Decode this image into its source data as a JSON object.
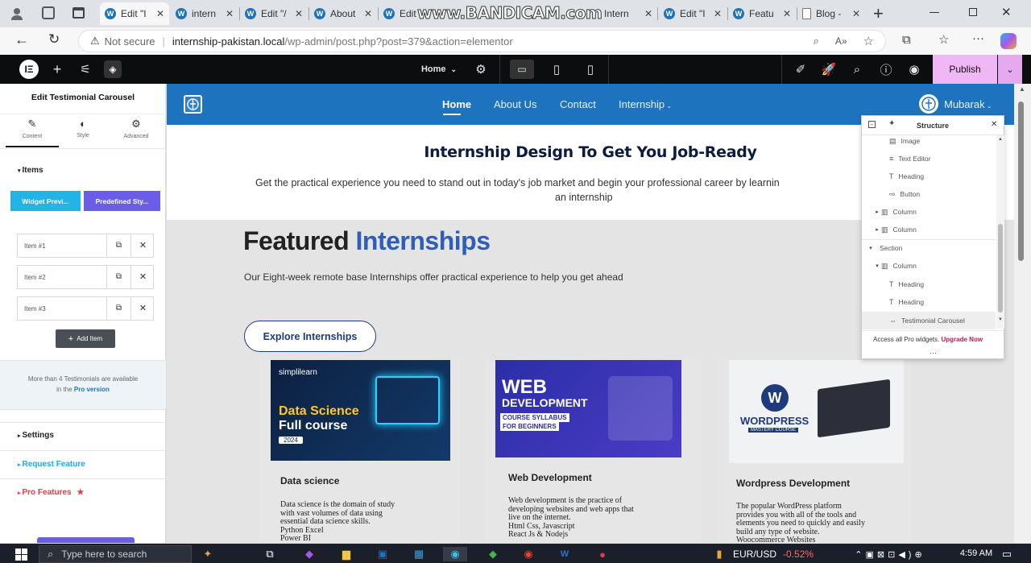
{
  "watermark": "www.BANDICAM.com",
  "browser": {
    "tabs": [
      {
        "label": "Edit \"I",
        "icon": "wordpress-icon"
      },
      {
        "label": "intern",
        "icon": "wordpress-icon"
      },
      {
        "label": "Edit \"/",
        "icon": "wordpress-icon"
      },
      {
        "label": "About",
        "icon": "wordpress-icon"
      },
      {
        "label": "Edit",
        "icon": "wordpress-icon"
      },
      {
        "label": "Intern",
        "icon": "wordpress-icon"
      },
      {
        "label": "Edit \"I",
        "icon": "wordpress-icon"
      },
      {
        "label": "Featu",
        "icon": "wordpress-icon"
      },
      {
        "label": "Blog -",
        "icon": "document-icon"
      }
    ],
    "not_secure": "Not secure",
    "url_host": "internship-pakistan.local",
    "url_path": "/wp-admin/post.php?post=379&action=elementor"
  },
  "editor": {
    "page_selector": "Home",
    "publish": "Publish"
  },
  "panel": {
    "title": "Edit Testimonial Carousel",
    "tabs": [
      "Content",
      "Style",
      "Advanced"
    ],
    "items_heading": "Items",
    "widget_preview": "Widget Previ...",
    "predefined_style": "Predefined Sty...",
    "items": [
      "Item #1",
      "Item #2",
      "Item #3"
    ],
    "add_item": "Add Item",
    "pro_note_1": "More than 4 Testimonials are available",
    "pro_note_2": "in the",
    "pro_note_link": "Pro version",
    "settings": "Settings",
    "request_feature": "Request Feature",
    "pro_features": "Pro Features"
  },
  "site": {
    "nav": [
      "Home",
      "About Us",
      "Contact",
      "Internship"
    ],
    "user": "Mubarak",
    "hero_title": "Internship Design To Get You Job-Ready",
    "hero_text_1": "Get the practical experience you need to stand out in today's job market and begin your professional career by learnin",
    "hero_text_2": "an internship",
    "featured_word1": "Featured",
    "featured_word2": "Internships",
    "featured_sub": "Our Eight-week remote base Internships offer practical experience to help you get ahead",
    "explore_btn": "Explore Internships",
    "cards": [
      {
        "img_brand": "simplilearn",
        "img_line1": "Data Science",
        "img_line2": "Full course",
        "img_year": "2024",
        "title": "Data science",
        "text": [
          "Data science is the domain of study",
          "with vast volumes of data using",
          "essential data science skills.",
          "Python Excel",
          "Power BI"
        ]
      },
      {
        "img_brand": "WEB",
        "img_line1": "DEVELOPMENT",
        "img_line2": "COURSE SYLLABUS",
        "img_year": "FOR BEGINNERS",
        "title": "Web Development",
        "text": [
          "Web development is the practice of",
          "developing websites and web apps that",
          "live on the internet.",
          "Html Css, Javascript",
          "React Js & Nodejs"
        ]
      },
      {
        "img_brand": "WORDPRESS",
        "img_line1": "MASTERY COURSE",
        "img_line2": "",
        "img_year": "",
        "title": "Wordpress Development",
        "text": [
          "The popular WordPress platform",
          "provides you with all of the tools and",
          "elements you need to quickly and easily",
          "build any type of website.",
          "Woocommerce Websites"
        ]
      }
    ]
  },
  "structure": {
    "title": "Structure",
    "rows": [
      {
        "label": "Image",
        "icon": "image-icon",
        "level": 2,
        "arrow": ""
      },
      {
        "label": "Text Editor",
        "icon": "text-editor-icon",
        "level": 2,
        "arrow": ""
      },
      {
        "label": "Heading",
        "icon": "heading-icon",
        "level": 2,
        "arrow": ""
      },
      {
        "label": "Button",
        "icon": "button-icon",
        "level": 2,
        "arrow": ""
      },
      {
        "label": "Column",
        "icon": "column-icon",
        "level": 1,
        "arrow": "▸"
      },
      {
        "label": "Column",
        "icon": "column-icon",
        "level": 1,
        "arrow": "▸"
      },
      {
        "label": "Section",
        "icon": "",
        "level": 0,
        "arrow": "▾"
      },
      {
        "label": "Column",
        "icon": "column-icon",
        "level": 1,
        "arrow": "▾"
      },
      {
        "label": "Heading",
        "icon": "heading-icon",
        "level": 2,
        "arrow": ""
      },
      {
        "label": "Heading",
        "icon": "heading-icon",
        "level": 2,
        "arrow": ""
      },
      {
        "label": "Testimonial Carousel",
        "icon": "carousel-icon",
        "level": 2,
        "arrow": ""
      }
    ],
    "footer_text": "Access all Pro widgets.",
    "footer_link": "Upgrade Now"
  },
  "taskbar": {
    "search_placeholder": "Type here to search",
    "ticker": "EUR/USD",
    "ticker_change": "-0.52%",
    "time": "4:59 AM"
  },
  "colors": {
    "elementor_dark": "#0c0d0e",
    "publish_bg": "#f0b7f5",
    "site_blue": "#1e73be",
    "heading_blue": "#2e5eb5",
    "panel_cyan": "#22b4e6",
    "panel_purple": "#6a5ee8",
    "pro_red": "#e23b45",
    "upgrade_magenta": "#c2185b"
  }
}
